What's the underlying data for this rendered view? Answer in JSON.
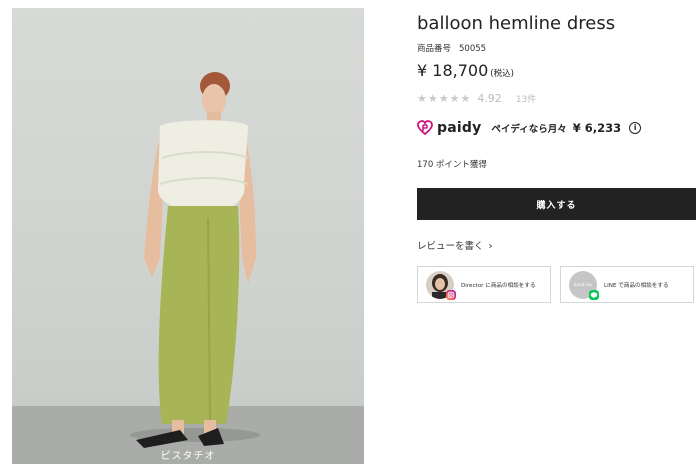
{
  "product": {
    "title": "balloon hemline dress",
    "sku_label": "商品番号",
    "sku_value": "50055",
    "price": "¥ 18,700",
    "tax_note": "(税込)",
    "rating_stars": "★★★★★",
    "rating_score": "4.92",
    "review_count": "13件",
    "points": "170 ポイント獲得",
    "photo_caption": "ピスタチオ"
  },
  "paidy": {
    "logo_text": "paidy",
    "monthly_label": "ペイディなら月々",
    "monthly_price": "¥ 6,233",
    "info_glyph": "i"
  },
  "actions": {
    "buy_label": "購入する",
    "review_link": "レビューを書く",
    "review_chevron": "›"
  },
  "contact_cards": [
    {
      "label": "Director に商品の相談をする",
      "avatar_caption": "",
      "badge": "instagram-icon"
    },
    {
      "label": "LINE で商品の相談をする",
      "avatar_caption": "dasbrau",
      "badge": "line-icon"
    }
  ],
  "colors": {
    "buy_button": "#222222",
    "paidy_accent": "#c8177e",
    "star": "#c9c9c9",
    "line_green": "#06c755",
    "skirt_green": "#a7b556"
  }
}
